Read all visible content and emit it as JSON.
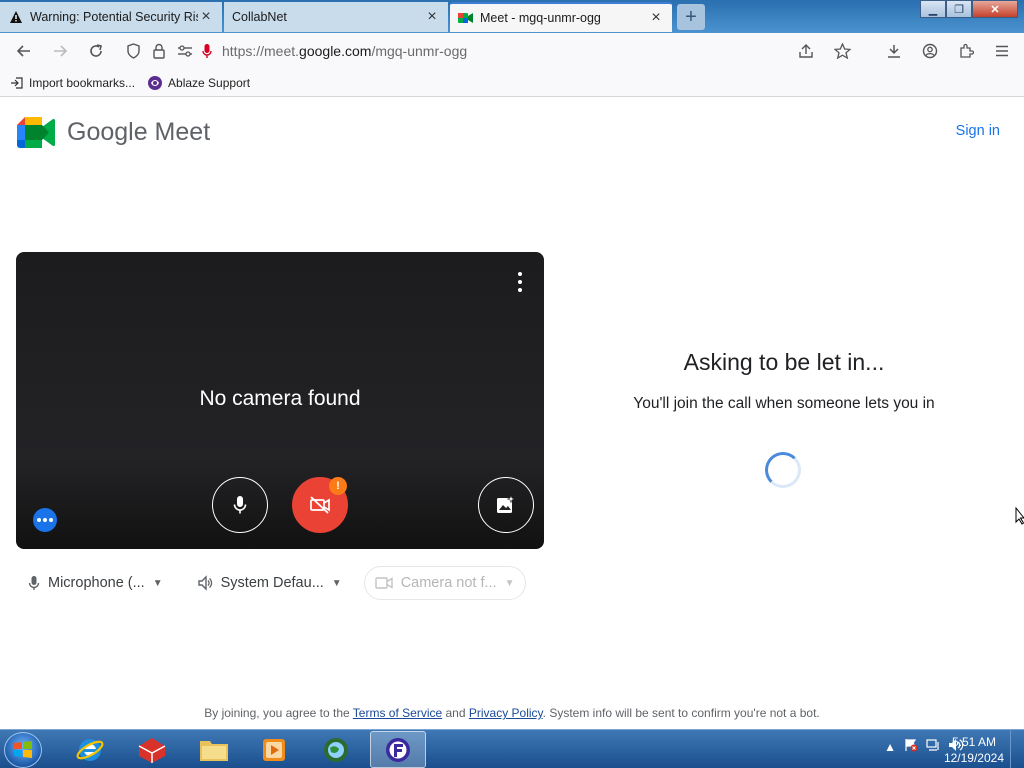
{
  "browser": {
    "tabs": [
      {
        "label": "Warning: Potential Security Risk",
        "icon": "warning-icon",
        "active": false
      },
      {
        "label": "CollabNet",
        "icon": "none",
        "active": false
      },
      {
        "label": "Meet - mgq-unmr-ogg",
        "icon": "meet-icon",
        "active": true
      }
    ],
    "url_prefix": "https://meet.",
    "url_domain": "google.com",
    "url_path": "/mgq-unmr-ogg",
    "bookmarks": [
      {
        "label": "Import bookmarks...",
        "icon": "import-icon"
      },
      {
        "label": "Ablaze Support",
        "icon": "ablaze-icon"
      }
    ]
  },
  "meet": {
    "logo_text": "Google Meet",
    "sign_in": "Sign in",
    "no_camera": "No camera found",
    "badge": "!",
    "devices": {
      "microphone": "Microphone (...",
      "speaker": "System Defau...",
      "camera": "Camera not f..."
    },
    "asking_title": "Asking to be let in...",
    "asking_sub": "You'll join the call when someone lets you in",
    "footer": {
      "prefix": "By joining, you agree to the ",
      "terms": "Terms of Service",
      "and": " and ",
      "privacy": "Privacy Policy",
      "suffix": ". System info will be sent to confirm you're not a bot."
    }
  },
  "taskbar": {
    "time": "5:51 AM",
    "date": "12/19/2024"
  },
  "colors": {
    "accent": "#1a73e8",
    "camera_off": "#ea4335",
    "warning_badge": "#fa7b17"
  }
}
